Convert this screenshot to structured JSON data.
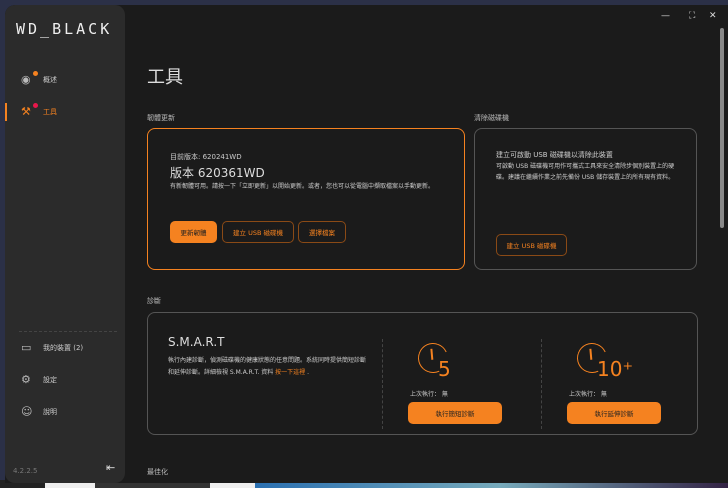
{
  "app": {
    "logo": "WD_BLACK",
    "version": "4.2.2.5"
  },
  "window_controls": {
    "minimize": "—",
    "maximize": "⛶",
    "close": "✕"
  },
  "sidebar": {
    "items": [
      {
        "label": "概述",
        "icon": "eye-icon",
        "active": false,
        "badge_color": "#f58220"
      },
      {
        "label": "工具",
        "icon": "tools-icon",
        "active": true,
        "badge_color": "#e8174b"
      }
    ],
    "bottom": [
      {
        "label": "我的裝置 (2)",
        "icon": "devices-icon"
      },
      {
        "label": "設定",
        "icon": "gear-icon"
      },
      {
        "label": "說明",
        "icon": "help-icon"
      }
    ]
  },
  "page": {
    "title": "工具"
  },
  "firmware": {
    "section": "韌體更新",
    "current": "目前版本: 620241WD",
    "new_version": "版本 620361WD",
    "desc": "有新韌體可用。請按一下「立即更新」以開始更新。或者，您也可以從電腦中擷取檔案以手動更新。",
    "buttons": [
      "更新韌體",
      "建立 USB 磁碟機",
      "選擇檔案"
    ]
  },
  "erase": {
    "section": "清除磁碟機",
    "title": "建立可啟動 USB 磁碟機以清除此裝置",
    "desc": "可啟動 USB 磁碟機可用作可攜式工具來安全清除步個別裝置上的硬碟。建議在繼續作業之前先備份 USB 儲存裝置上的所有現有資料。",
    "button": "建立 USB 磁碟機"
  },
  "diagnostics": {
    "section": "診斷",
    "title": "S.M.A.R.T",
    "desc": "執行內建診斷，偵測磁碟機的健康狀態的任意問題。系統同時提供簡短診斷和延伸診斷。詳細檢視 S.M.A.R.T. 資料",
    "link": "按一下這裡",
    "link_suffix": ".",
    "tests": [
      {
        "minutes": "5",
        "last_run": "上次執行： 無",
        "button": "執行簡短診斷"
      },
      {
        "minutes": "10⁺",
        "last_run": "上次執行： 無",
        "button": "執行延伸診斷"
      }
    ]
  },
  "optimize": {
    "section": "最佳化"
  },
  "colors": {
    "accent": "#f58220"
  }
}
